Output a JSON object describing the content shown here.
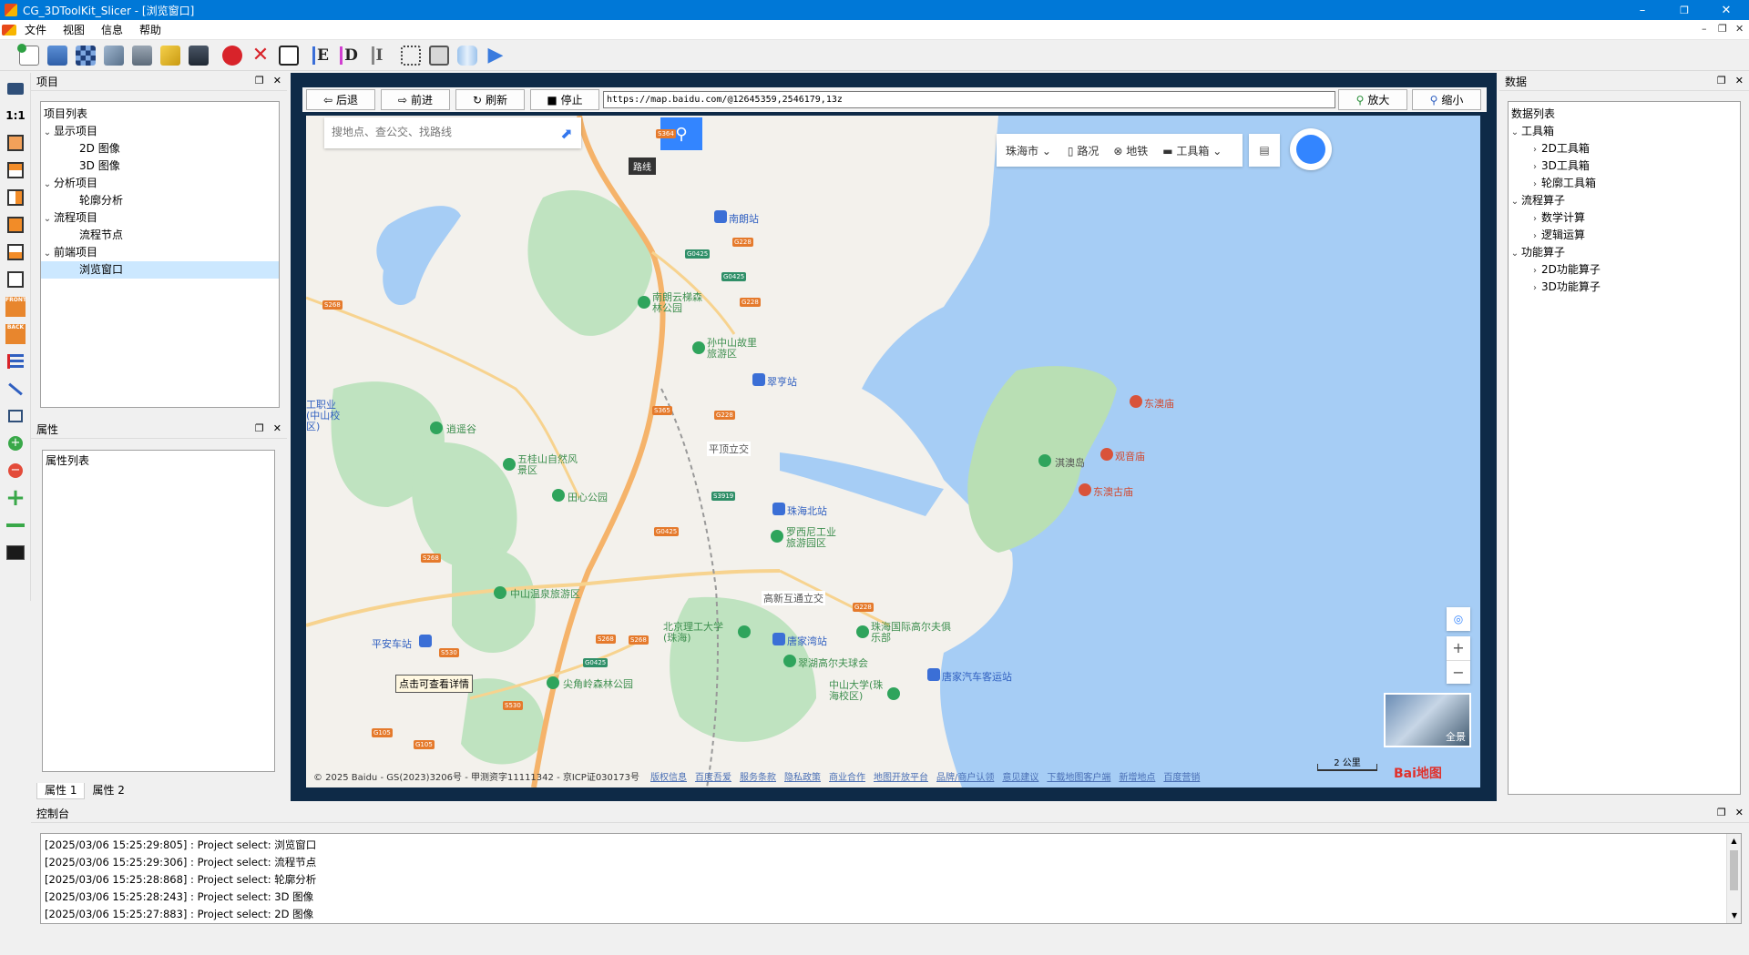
{
  "window": {
    "title": "CG_3DToolKit_Slicer - [浏览窗口]",
    "minimize": "–",
    "maximize": "❐",
    "close": "✕"
  },
  "menu": {
    "items": [
      "文件",
      "视图",
      "信息",
      "帮助"
    ],
    "mdi_controls": [
      "–",
      "❐",
      "✕"
    ]
  },
  "toolbar": {
    "text_buttons": [
      "E",
      "D",
      "I"
    ]
  },
  "left_toolbar": {
    "ratio_label": "1:1",
    "front_label": "FRONT",
    "back_label": "BACK"
  },
  "project_panel": {
    "title": "项目",
    "root": "项目列表",
    "groups": [
      {
        "label": "显示项目",
        "children": [
          "2D  图像",
          "3D  图像"
        ]
      },
      {
        "label": "分析项目",
        "children": [
          "轮廓分析"
        ]
      },
      {
        "label": "流程项目",
        "children": [
          "流程节点"
        ]
      },
      {
        "label": "前端项目",
        "children": [
          "浏览窗口"
        ]
      }
    ],
    "selected": "浏览窗口"
  },
  "properties_panel": {
    "title": "属性",
    "root": "属性列表",
    "tabs": [
      "属性 1",
      "属性 2"
    ]
  },
  "data_panel": {
    "title": "数据",
    "root": "数据列表",
    "groups": [
      {
        "label": "工具箱",
        "children": [
          "2D工具箱",
          "3D工具箱",
          "轮廓工具箱"
        ]
      },
      {
        "label": "流程算子",
        "children": [
          "数学计算",
          "逻辑运算"
        ]
      },
      {
        "label": "功能算子",
        "children": [
          "2D功能算子",
          "3D功能算子"
        ]
      }
    ]
  },
  "browser": {
    "back": "后退",
    "forward": "前进",
    "refresh": "刷新",
    "stop": "停止",
    "url": "https://map.baidu.com/@12645359,2546179,13z",
    "zoom_in": "放大",
    "zoom_out": "缩小"
  },
  "map": {
    "search_placeholder": "搜地点、查公交、找路线",
    "route_tooltip": "路线",
    "city": "珠海市",
    "road_conditions": "路况",
    "subway": "地铁",
    "toolbox": "工具箱",
    "detail_hint": "点击可查看详情",
    "panorama": "全景",
    "scale": "2 公里",
    "copyright": "© 2025 Baidu - GS(2023)3206号 - 甲测资字11111342 - 京ICP证030173号",
    "footer_links": [
      "版权信息",
      "百度吾爱",
      "服务条款",
      "隐私政策",
      "商业合作",
      "地图开放平台",
      "品牌/商户认领",
      "意见建议",
      "下载地图客户端",
      "新增地点",
      "百度营销"
    ],
    "logo": "Bai地图",
    "pois_green": [
      "南朗云梯森林公园",
      "孙中山故里旅游区",
      "逍遥谷",
      "五桂山自然风景区",
      "田心公园",
      "罗西尼工业旅游园区",
      "中山温泉旅游区",
      "尖角岭森林公园",
      "淇澳岛",
      "北京理工大学(珠海)",
      "珠海国际高尔夫俱乐部",
      "翠湖高尔夫球会",
      "中山大学(珠海校区)"
    ],
    "pois_blue": [
      "南朗站",
      "翠亨站",
      "珠海北站",
      "唐家湾站",
      "平安车站",
      "唐家汽车客运站"
    ],
    "pois_red": [
      "东澳庙",
      "观音庙",
      "东澳古庙"
    ],
    "place_labels": [
      "平顶立交",
      "高新互通立交",
      "工职业(中山校区)"
    ],
    "road_shields": [
      "S364",
      "G228",
      "G0425",
      "S268",
      "S365",
      "S3919",
      "S530",
      "G105"
    ]
  },
  "console": {
    "title": "控制台",
    "lines": [
      "[2025/03/06 15:25:29:805] : Project select: 浏览窗口",
      "[2025/03/06 15:25:29:306] : Project select: 流程节点",
      "[2025/03/06 15:25:28:868] : Project select: 轮廓分析",
      "[2025/03/06 15:25:28:243] : Project select: 3D  图像",
      "[2025/03/06 15:25:27:883] : Project select: 2D  图像"
    ]
  }
}
